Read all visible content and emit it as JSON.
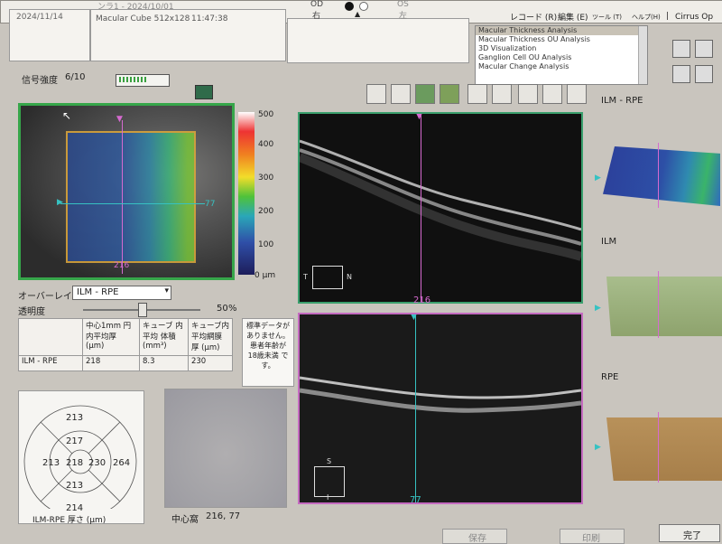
{
  "header": {
    "date": "2024/11/14",
    "date_prefix_fragment": "ンラ1 - 2024/10/01",
    "scan_type": "Macular Cube 512x128",
    "scan_time": "11:47:38",
    "eye_od": "OD",
    "eye_od_jp": "右",
    "eye_os": "OS",
    "eye_os_jp": "左"
  },
  "menubar": {
    "record": "レコード (R)",
    "edit": "編集 (E)",
    "tools": "ツール (T)",
    "help": "ヘルプ(H)",
    "separator": "|",
    "brand": "Cirrus Op"
  },
  "analysis_list": {
    "items": [
      "Macular Thickness Analysis",
      "Macular Thickness OU Analysis",
      "3D Visualization",
      "Ganglion Cell OU Analysis",
      "Macular Change Analysis"
    ],
    "selected_index": 0
  },
  "signal": {
    "label": "信号強度",
    "value": "6/10",
    "level": 0.6
  },
  "colorbar": {
    "ticks": [
      "500",
      "400",
      "300",
      "200",
      "100",
      "0 μm"
    ]
  },
  "fundus": {
    "marker_vertical": "216",
    "marker_horizontal": "77"
  },
  "bscan_top": {
    "orientation_left": "T",
    "orientation_right": "N",
    "slice_label": "216"
  },
  "bscan_bottom": {
    "orientation_top": "S",
    "orientation_bottom": "I",
    "slice_label": "77"
  },
  "overlay": {
    "label": "オーバーレイ",
    "selected": "ILM - RPE",
    "transparency_label": "透明度",
    "transparency_value": "50",
    "transparency_unit": "%",
    "transparency_level": 0.5
  },
  "measurement_table": {
    "col1": "中心1mm 円内平均厚 (μm)",
    "col2": "キューブ 内 平均 体積 (mm³)",
    "col3": "キューブ内 平均網膜 厚 (μm)",
    "row_label": "ILM - RPE",
    "val1": "218",
    "val2": "8.3",
    "val3": "230"
  },
  "norm_note": "標準データが ありません。 患者年齢が 18歳未満 です。",
  "etdrs": {
    "outer_top": "213",
    "inner_top": "217",
    "inner_left": "213",
    "center": "218",
    "inner_right": "230",
    "outer_right": "264",
    "inner_bottom": "213",
    "outer_bottom": "214",
    "caption": "ILM-RPE 厚さ (μm)"
  },
  "fovea": {
    "label": "中心窩",
    "coords": "216, 77"
  },
  "surfaces": {
    "top": "ILM - RPE",
    "middle": "ILM",
    "bottom": "RPE"
  },
  "buttons": {
    "finish": "完了",
    "print": "印刷",
    "save": "保存"
  },
  "colors": {
    "fundus_frame": "#36a64a",
    "bscan_top_frame": "#3a9f6d",
    "bscan_bottom_frame": "#c46ac0",
    "vertical_line": "#d66ad0",
    "horizontal_line": "#36c2c2",
    "map_frame": "#e0a93a"
  }
}
